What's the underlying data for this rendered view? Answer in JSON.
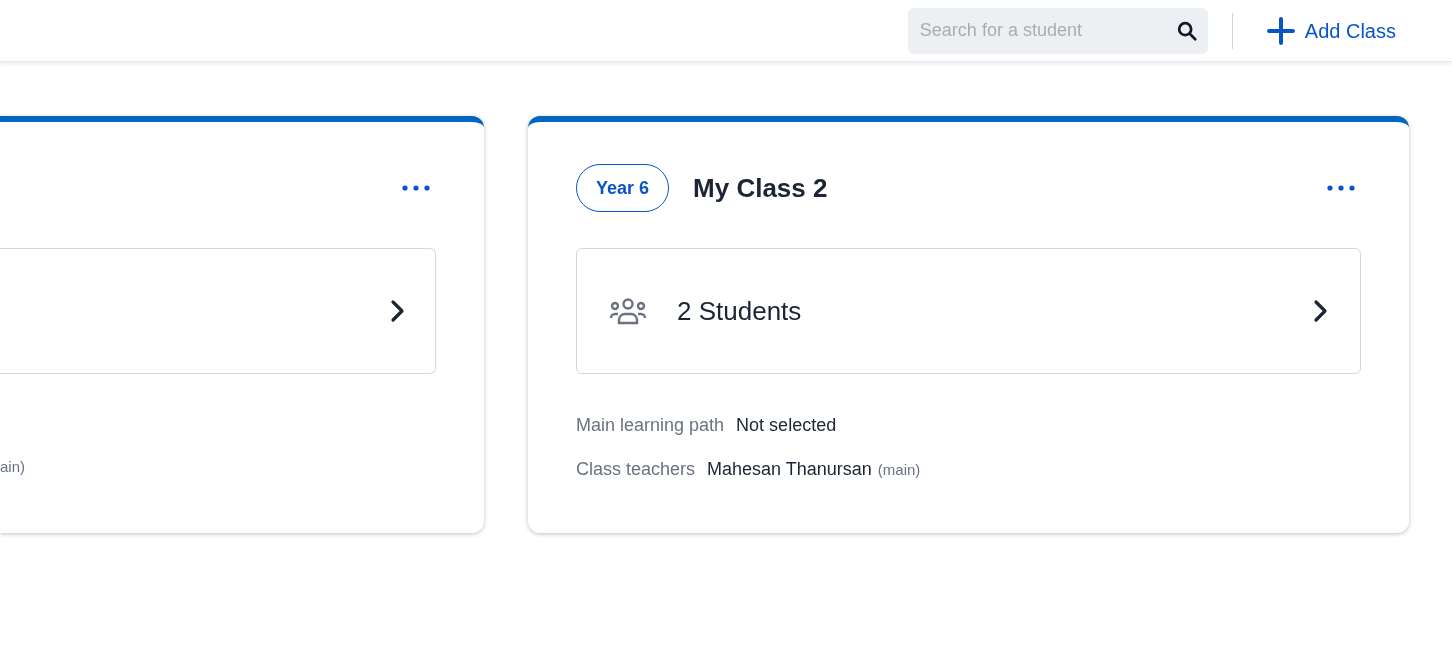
{
  "header": {
    "search": {
      "placeholder": "Search for a student"
    },
    "add_button": "Add Class"
  },
  "classes": [
    {
      "kind": "partial",
      "teacher_note": "ain)"
    },
    {
      "kind": "full",
      "year": "Year 6",
      "name": "My Class 2",
      "students": "2 Students",
      "learning_path_label": "Main learning path",
      "learning_path": "Not selected",
      "teachers_label": "Class teachers",
      "teacher": "Mahesan Thanursan",
      "teacher_note": "(main)"
    }
  ]
}
